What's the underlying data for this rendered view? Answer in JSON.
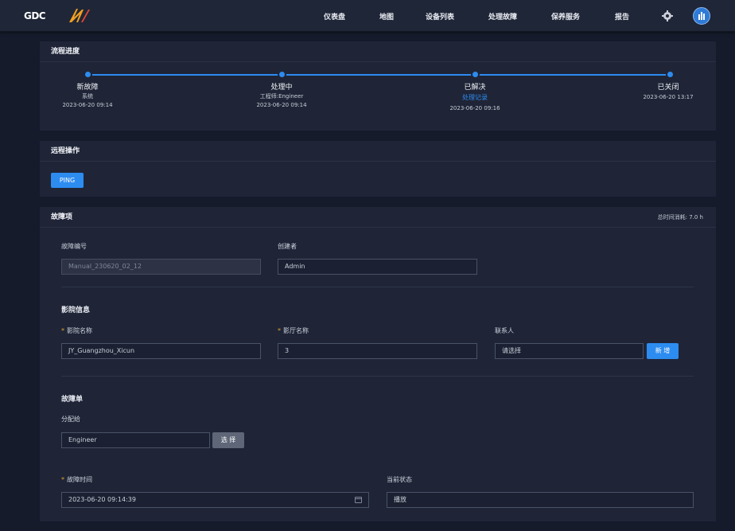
{
  "header": {
    "logo_text": "GDC",
    "nav": [
      {
        "label": "仪表盘"
      },
      {
        "label": "地图"
      },
      {
        "label": "设备列表"
      },
      {
        "label": "处理故障"
      },
      {
        "label": "保养服务"
      },
      {
        "label": "报告"
      }
    ],
    "icons": {
      "settings": "gear-icon",
      "avatar": "user-avatar-icon"
    }
  },
  "progress": {
    "title": "流程进度",
    "steps": [
      {
        "title": "新故障",
        "sub": "系统",
        "link": "",
        "time": "2023-06-20 09:14"
      },
      {
        "title": "处理中",
        "sub": "工程师:Engineer",
        "link": "",
        "time": "2023-06-20 09:14"
      },
      {
        "title": "已解决",
        "sub": "",
        "link": "处理记录",
        "time": "2023-06-20 09:16"
      },
      {
        "title": "已关闭",
        "sub": "",
        "link": "",
        "time": "2023-06-20 13:17"
      }
    ]
  },
  "remote": {
    "title": "远程操作",
    "ping_label": "PING"
  },
  "fault": {
    "title": "故障项",
    "total_time": "总时间消耗: 7.0 h",
    "fault_no_label": "故障编号",
    "fault_no_value": "Manual_230620_02_12",
    "creator_label": "创建者",
    "creator_value": "Admin",
    "cinema_section": "影院信息",
    "cinema_name_label": "影院名称",
    "cinema_name_value": "JY_Guangzhou_Xicun",
    "hall_name_label": "影厅名称",
    "hall_name_value": "3",
    "contact_label": "联系人",
    "contact_placeholder": "请选择",
    "add_button": "新 增",
    "ticket_section": "故障单",
    "assign_label": "分配给",
    "assign_value": "Engineer",
    "select_button": "选 择",
    "fault_time_label": "故障时间",
    "fault_time_value": "2023-06-20 09:14:39",
    "status_label": "当前状态",
    "status_value": "播放"
  },
  "colors": {
    "accent": "#2d8cf0",
    "background": "#151b2b",
    "panel": "#1f2537",
    "required": "#e0a030"
  }
}
